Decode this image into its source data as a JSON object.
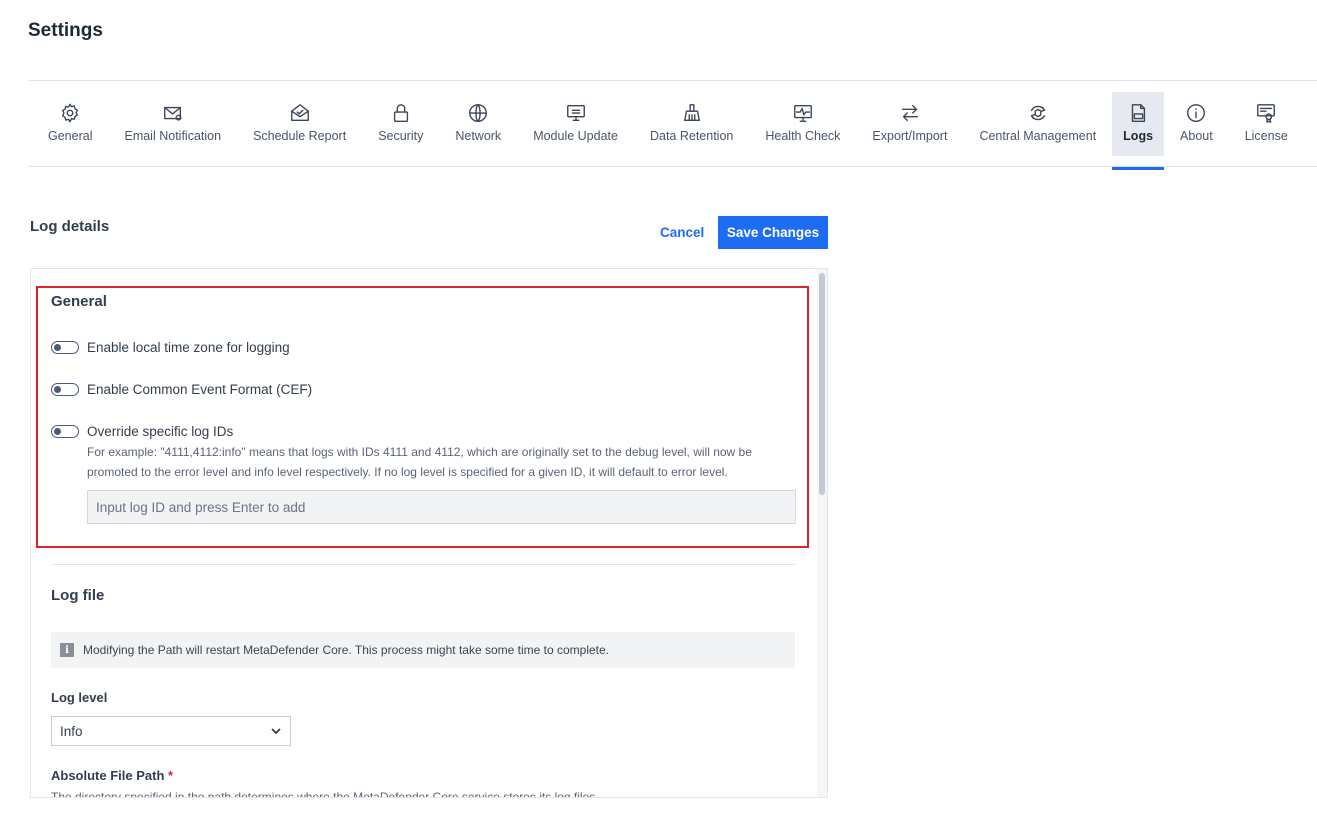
{
  "page": {
    "title": "Settings"
  },
  "tabs": [
    {
      "label": "General",
      "icon": "gear-icon"
    },
    {
      "label": "Email Notification",
      "icon": "email-icon"
    },
    {
      "label": "Schedule Report",
      "icon": "envelope-open-icon"
    },
    {
      "label": "Security",
      "icon": "lock-icon"
    },
    {
      "label": "Network",
      "icon": "globe-icon"
    },
    {
      "label": "Module Update",
      "icon": "monitor-icon"
    },
    {
      "label": "Data Retention",
      "icon": "broom-icon"
    },
    {
      "label": "Health Check",
      "icon": "heartbeat-monitor-icon"
    },
    {
      "label": "Export/Import",
      "icon": "arrows-swap-icon"
    },
    {
      "label": "Central Management",
      "icon": "central-management-icon"
    },
    {
      "label": "Logs",
      "icon": "log-file-icon",
      "active": true
    },
    {
      "label": "About",
      "icon": "info-icon"
    },
    {
      "label": "License",
      "icon": "license-icon"
    }
  ],
  "section": {
    "title": "Log details"
  },
  "actions": {
    "cancel_label": "Cancel",
    "save_label": "Save Changes"
  },
  "general": {
    "title": "General",
    "toggles": [
      {
        "label": "Enable local time zone for logging",
        "on": false
      },
      {
        "label": "Enable Common Event Format (CEF)",
        "on": false
      },
      {
        "label": "Override specific log IDs",
        "on": false
      }
    ],
    "override_help_line1": "For example: \"4111,4112:info\" means that logs with IDs 4111 and 4112, which are originally set to the debug level, will now be",
    "override_help_line2": "promoted to the error level and info level respectively. If no log level is specified for a given ID, it will default to error level.",
    "log_id_placeholder": "Input log ID and press Enter to add"
  },
  "log_file": {
    "title": "Log file",
    "info_text": "Modifying the Path will restart MetaDefender Core. This process might take some time to complete.",
    "log_level_label": "Log level",
    "log_level_value": "Info",
    "path_label": "Absolute File Path",
    "path_required_mark": "*",
    "path_description": "The directory specified in the path determines where the MetaDefender Core service stores its log files."
  },
  "colors": {
    "accent": "#1d6cf2",
    "highlight": "#d9232e"
  }
}
